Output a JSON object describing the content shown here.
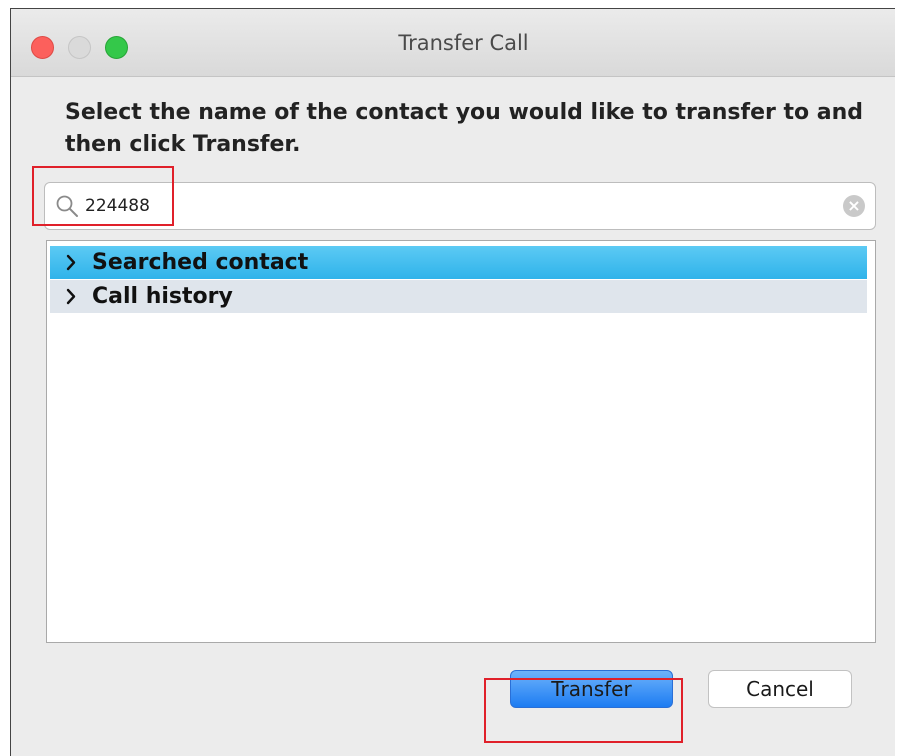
{
  "window": {
    "title": "Transfer Call"
  },
  "dialog": {
    "instruction": "Select the name of the contact you would like to transfer to and then click Transfer."
  },
  "search": {
    "value": "224488",
    "placeholder": ""
  },
  "list": {
    "items": [
      {
        "label": "Searched contact",
        "selected": true
      },
      {
        "label": "Call history",
        "selected": false
      }
    ]
  },
  "buttons": {
    "transfer_label": "Transfer",
    "cancel_label": "Cancel"
  },
  "colors": {
    "highlight_box": "#e0202a",
    "selected_row": "#39b9ef",
    "primary_button": "#2b86f5"
  },
  "icons": {
    "search": "search-icon",
    "clear": "clear-icon",
    "chevron": "chevron-right-icon"
  }
}
